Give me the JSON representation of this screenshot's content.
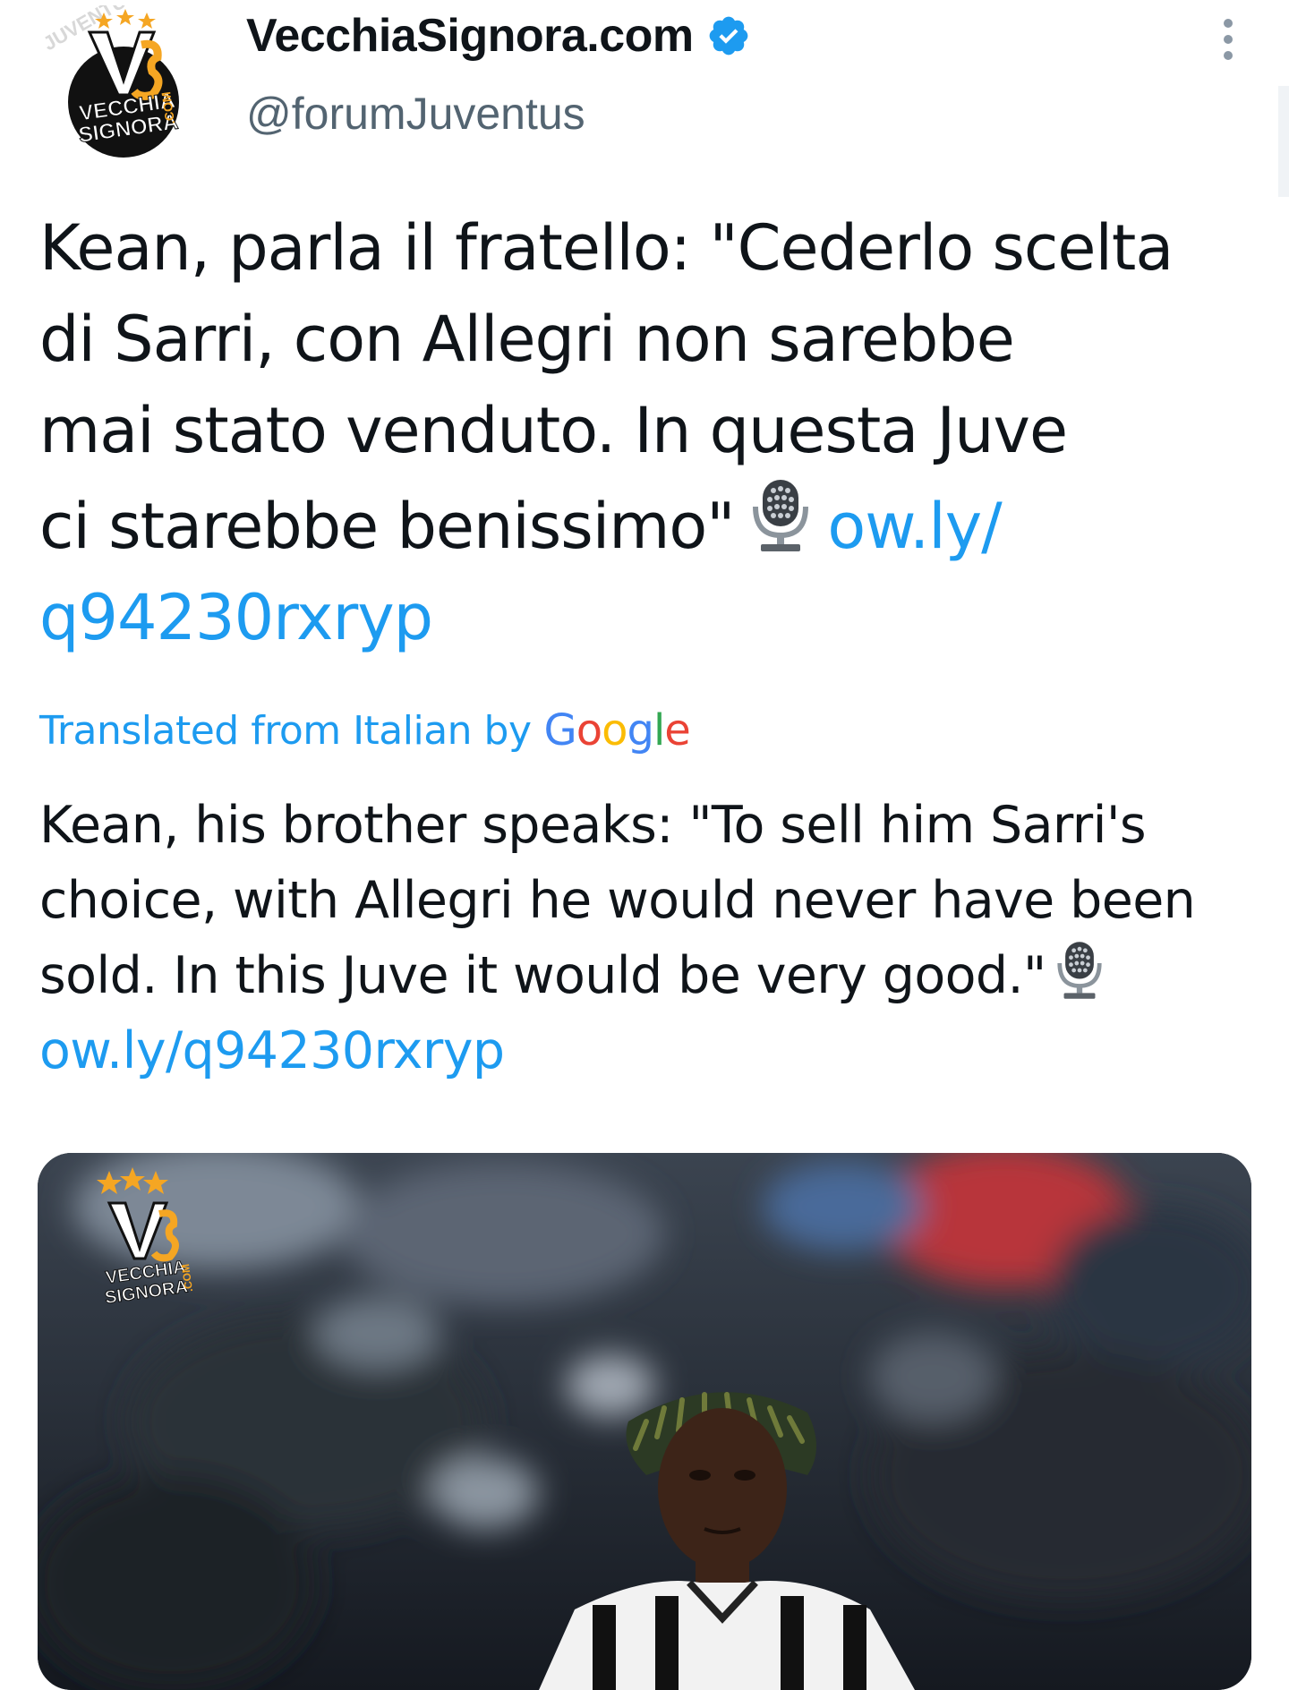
{
  "account": {
    "display_name": "VecchiaSignora.com",
    "handle": "@forumJuventus",
    "avatar_text_line1": "VECCHIA",
    "avatar_text_line2": "SIGNORA",
    "avatar_text_suffix": ".COM"
  },
  "tweet": {
    "original_lines": [
      "Kean, parla il fratello: \"Cederlo scelta",
      "di Sarri, con Allegri non sarebbe",
      "mai stato venduto. In questa Juve",
      "ci starebbe benissimo\""
    ],
    "original_link_part1": "ow.ly/",
    "original_link_part2": "q94230rxryp",
    "translated_label": "Translated from Italian by",
    "translator": "Google",
    "translation_lines": [
      "Kean, his brother speaks: \"To sell him Sarri's",
      "choice, with Allegri he would never have been",
      "sold. In this Juve it would be very good.\""
    ],
    "translation_link": "ow.ly/q94230rxryp"
  },
  "media": {
    "watermark_line1": "VECCHIA",
    "watermark_line2": "SIGNORA",
    "watermark_suffix": ".COM"
  },
  "colors": {
    "link": "#1d9bf0",
    "verified": "#1d9bf0",
    "text": "#0f1419",
    "secondary_text": "#536471"
  },
  "icons": [
    "verified-badge-icon",
    "more-options-icon",
    "microphone-icon"
  ]
}
